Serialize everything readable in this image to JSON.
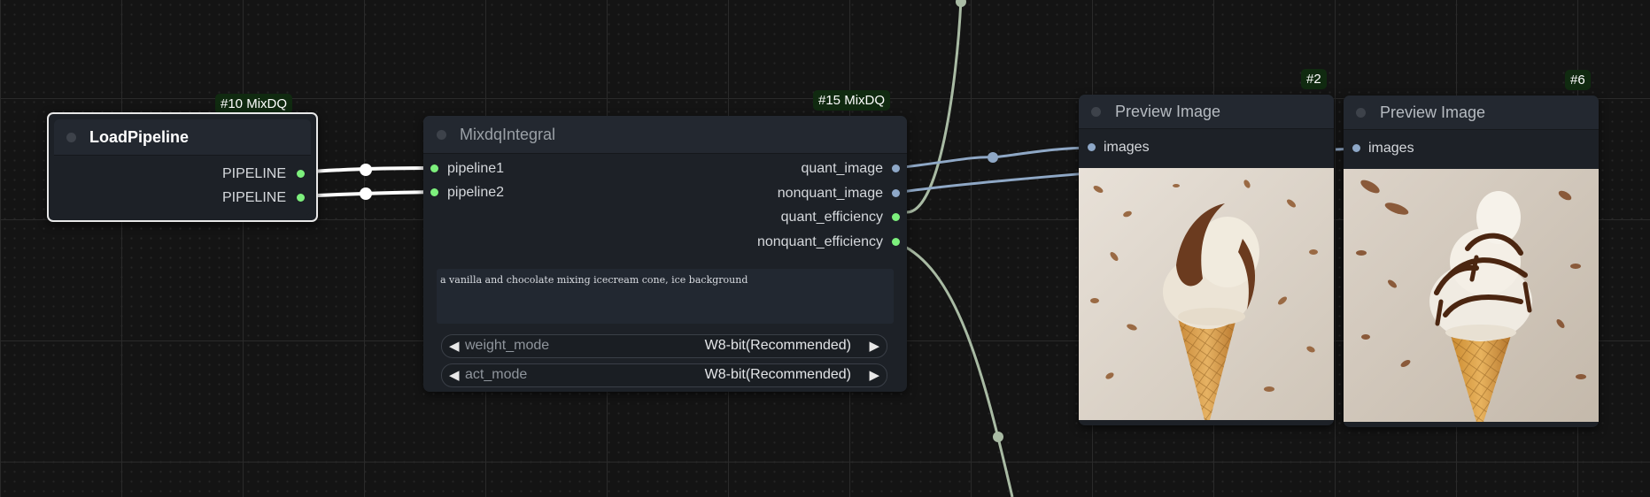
{
  "nodes": {
    "load_pipeline": {
      "badge": "#10 MixDQ",
      "title": "LoadPipeline",
      "outputs": [
        "PIPELINE",
        "PIPELINE"
      ]
    },
    "mixdq_integral": {
      "badge": "#15 MixDQ",
      "title": "MixdqIntegral",
      "inputs": [
        "pipeline1",
        "pipeline2"
      ],
      "outputs": [
        "quant_image",
        "nonquant_image",
        "quant_efficiency",
        "nonquant_efficiency"
      ],
      "prompt": "a vanilla and chocolate mixing icecream cone, ice background",
      "weight_mode": {
        "label": "weight_mode",
        "value": "W8-bit(Recommended)"
      },
      "act_mode": {
        "label": "act_mode",
        "value": "W8-bit(Recommended)"
      }
    },
    "preview_2": {
      "badge": "#2",
      "title": "Preview Image",
      "input": "images",
      "image_desc": "ice-cream-cone-image"
    },
    "preview_6": {
      "badge": "#6",
      "title": "Preview Image",
      "input": "images",
      "image_desc": "ice-cream-cone-image"
    }
  },
  "colors": {
    "pipeline_slot": "#7df07d",
    "image_slot": "#8ea8c8",
    "image_wire": "#8fa8c6",
    "float_wire": "#a9bba4",
    "pipeline_wire": "#ffffff",
    "badge_bg": "#102a10"
  }
}
